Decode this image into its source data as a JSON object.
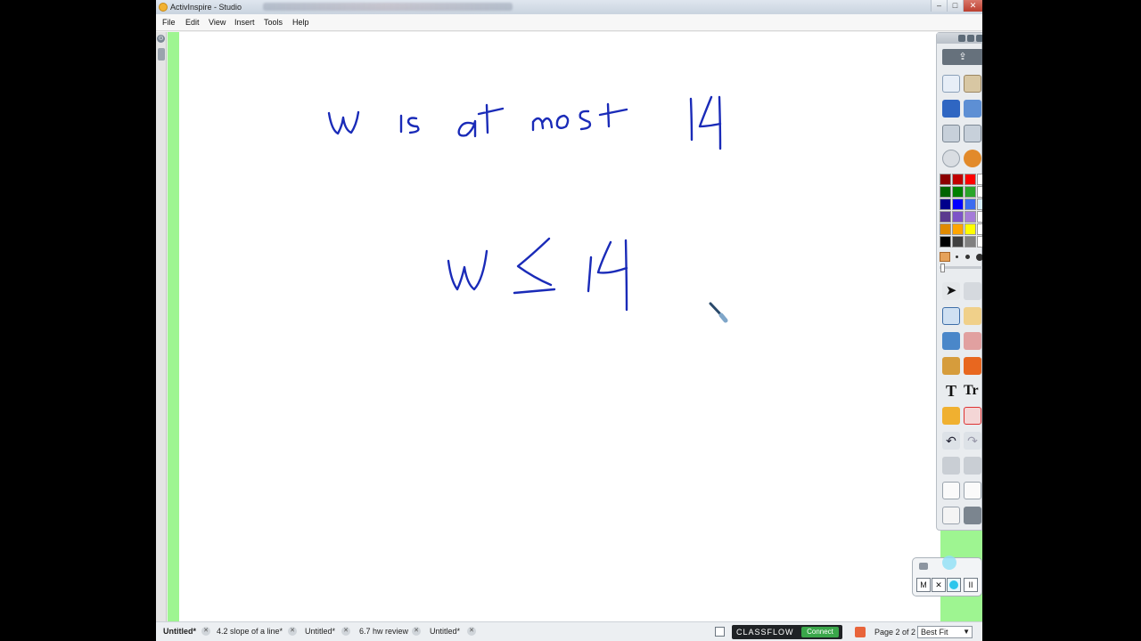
{
  "window": {
    "title": "ActivInspire - Studio"
  },
  "menubar": {
    "items": [
      "File",
      "Edit",
      "View",
      "Insert",
      "Tools",
      "Help"
    ]
  },
  "canvas": {
    "handwritten_line_1": "w is at most 14",
    "handwritten_line_2": "w ≤ 14",
    "ink_color": "#1a2bb8"
  },
  "tabs": [
    {
      "label": "Untitled*",
      "active": true
    },
    {
      "label": "4.2 slope of a line*",
      "active": false
    },
    {
      "label": "Untitled*",
      "active": false
    },
    {
      "label": "6.7 hw review",
      "active": false
    },
    {
      "label": "Untitled*",
      "active": false
    }
  ],
  "classflow": {
    "brand": "CLASSFLOW",
    "connect_label": "Connect"
  },
  "page_indicator": "Page 2 of 2",
  "zoom": {
    "value": "Best Fit"
  },
  "recorder": {
    "buttons": [
      "M",
      "✕",
      "",
      "II"
    ]
  },
  "colors": {
    "palette": [
      [
        "#8b0000",
        "#c00000",
        "#ff0000",
        "#ffffff"
      ],
      [
        "#006400",
        "#008000",
        "#2aa52a",
        "#ffffff"
      ],
      [
        "#00008b",
        "#0000ff",
        "#3a6cf0",
        "#ffffff"
      ],
      [
        "#5b3a8e",
        "#7d55c7",
        "#a57cd8",
        "#ffffff"
      ],
      [
        "#e08a00",
        "#ffa500",
        "#ffff00",
        "#ffffff"
      ],
      [
        "#000000",
        "#404040",
        "#808080",
        "#ffffff"
      ]
    ],
    "green_margin": "#9ef591"
  }
}
